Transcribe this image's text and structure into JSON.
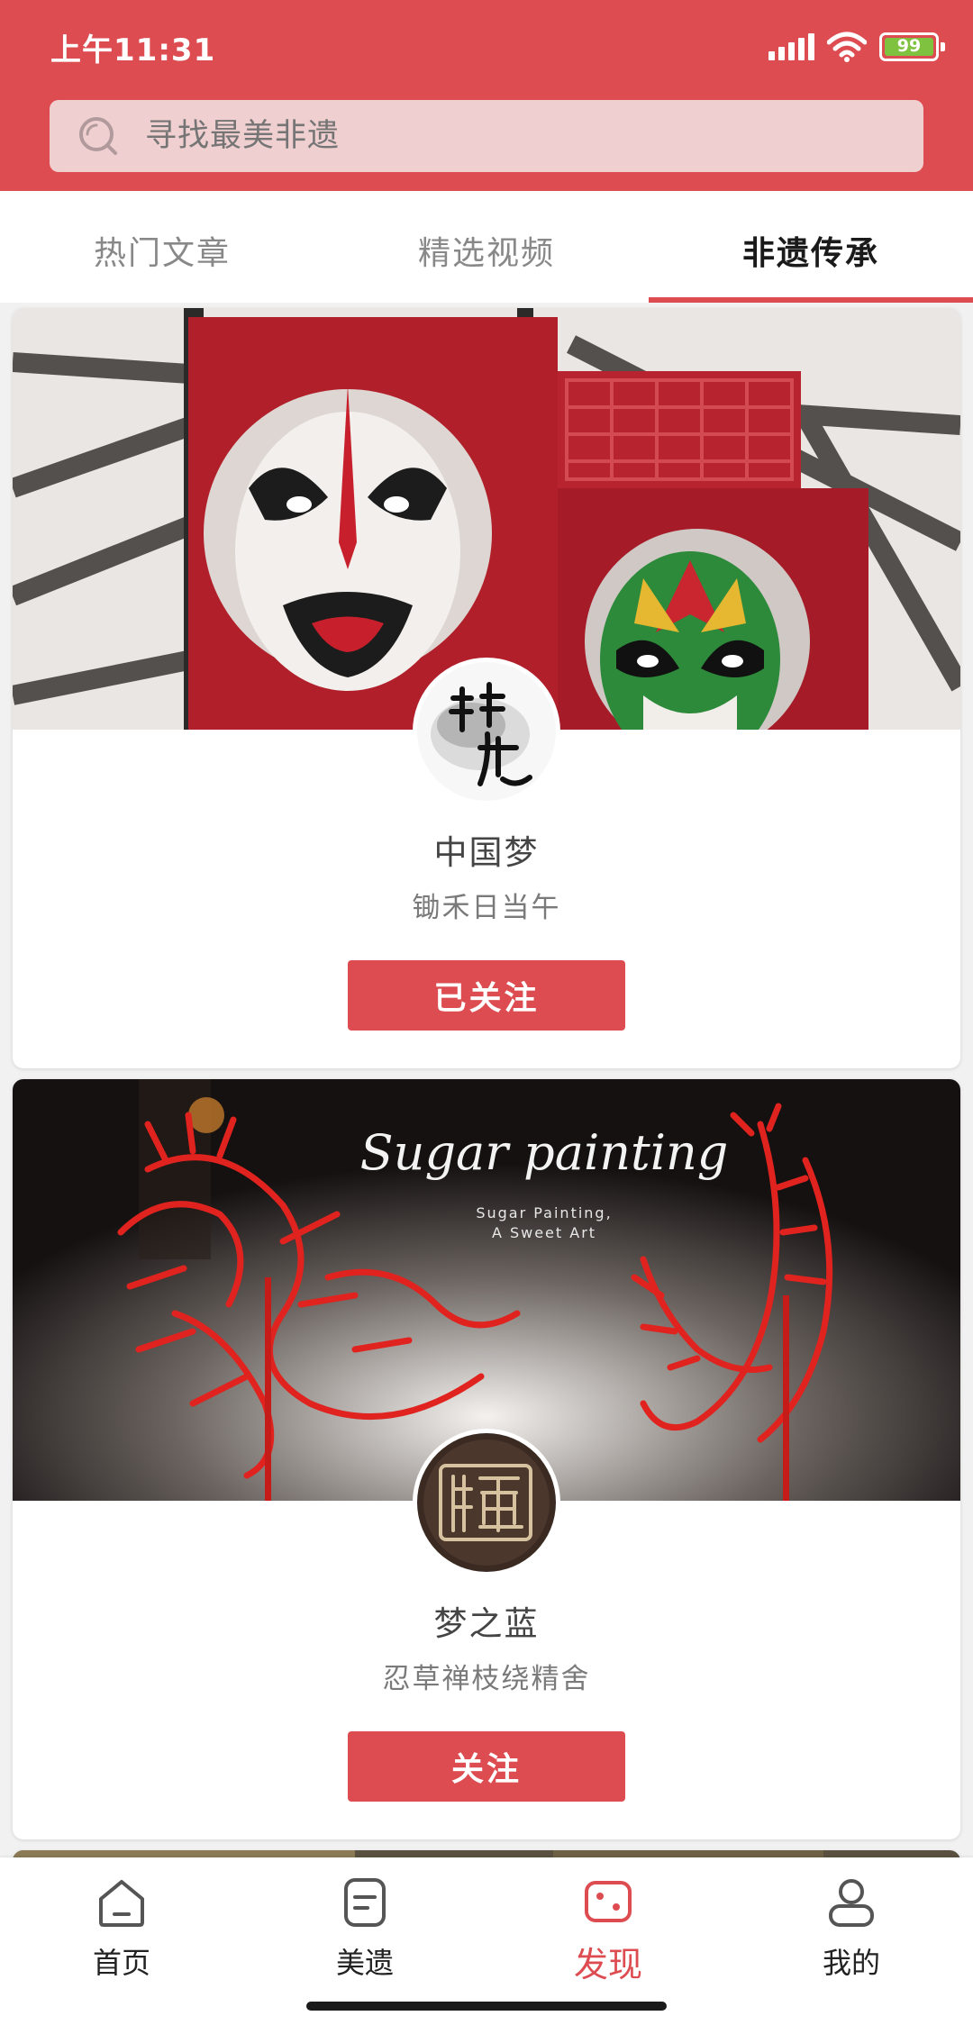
{
  "status_bar": {
    "time": "上午11:31",
    "battery": "99"
  },
  "search": {
    "placeholder": "寻找最美非遗"
  },
  "tabs": [
    {
      "label": "热门文章",
      "active": false
    },
    {
      "label": "精选视频",
      "active": false
    },
    {
      "label": "非遗传承",
      "active": true
    }
  ],
  "cards": [
    {
      "avatar_text": "非遗",
      "name": "中国梦",
      "motto": "锄禾日当午",
      "button": "已关注"
    },
    {
      "avatar_text": "糖",
      "name": "梦之蓝",
      "motto": "忍草禅枝绕精舍",
      "button": "关注",
      "cover_title": "Sugar painting",
      "cover_subtitle_1": "Sugar Painting,",
      "cover_subtitle_2": "A Sweet Art"
    }
  ],
  "nav": [
    {
      "label": "首页",
      "icon": "home-icon"
    },
    {
      "label": "美遗",
      "icon": "document-icon"
    },
    {
      "label": "发现",
      "icon": "discover-icon",
      "active": true
    },
    {
      "label": "我的",
      "icon": "profile-icon"
    }
  ],
  "colors": {
    "accent": "#dd4c50",
    "search_bg": "#f0cfd0"
  }
}
